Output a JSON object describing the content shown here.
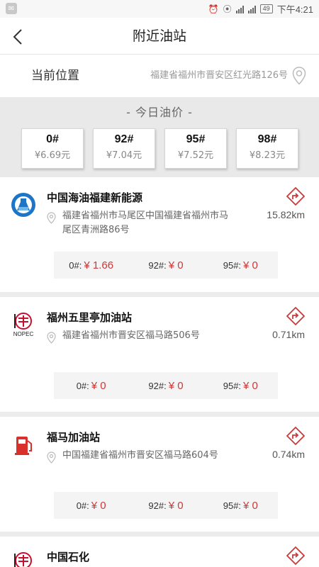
{
  "status_bar": {
    "time": "下午4:21",
    "battery": "49",
    "network_label_1": "3G",
    "network_label_2": "2G"
  },
  "header": {
    "title": "附近油站"
  },
  "location": {
    "label": "当前位置",
    "address": "福建省福州市晋安区红光路126号"
  },
  "today_prices": {
    "title": "- 今日油价 -",
    "items": [
      {
        "grade": "0#",
        "price": "¥6.69元"
      },
      {
        "grade": "92#",
        "price": "¥7.04元"
      },
      {
        "grade": "95#",
        "price": "¥7.52元"
      },
      {
        "grade": "98#",
        "price": "¥8.23元"
      }
    ]
  },
  "stations": [
    {
      "name": "中国海油福建新能源",
      "address": "福建省福州市马尾区中国福建省福州市马尾区青洲路86号",
      "distance": "15.82km",
      "logo": "cnooc-logo",
      "prices": [
        {
          "label": "0#:",
          "value": "¥ 1.66"
        },
        {
          "label": "92#:",
          "value": "¥ 0"
        },
        {
          "label": "95#:",
          "value": "¥ 0"
        }
      ]
    },
    {
      "name": "福州五里亭加油站",
      "address": "福建省福州市晋安区福马路506号",
      "distance": "0.71km",
      "logo": "sinopec-logo",
      "prices": [
        {
          "label": "0#:",
          "value": "¥ 0"
        },
        {
          "label": "92#:",
          "value": "¥ 0"
        },
        {
          "label": "95#:",
          "value": "¥ 0"
        }
      ]
    },
    {
      "name": "福马加油站",
      "address": "中国福建省福州市晋安区福马路604号",
      "distance": "0.74km",
      "logo": "fuel-pump-logo",
      "prices": [
        {
          "label": "0#:",
          "value": "¥ 0"
        },
        {
          "label": "92#:",
          "value": "¥ 0"
        },
        {
          "label": "95#:",
          "value": "¥ 0"
        }
      ]
    },
    {
      "name": "中国石化",
      "logo": "sinopec-logo"
    }
  ],
  "colors": {
    "accent_red": "#c93a3a",
    "page_bg": "#ececec"
  }
}
